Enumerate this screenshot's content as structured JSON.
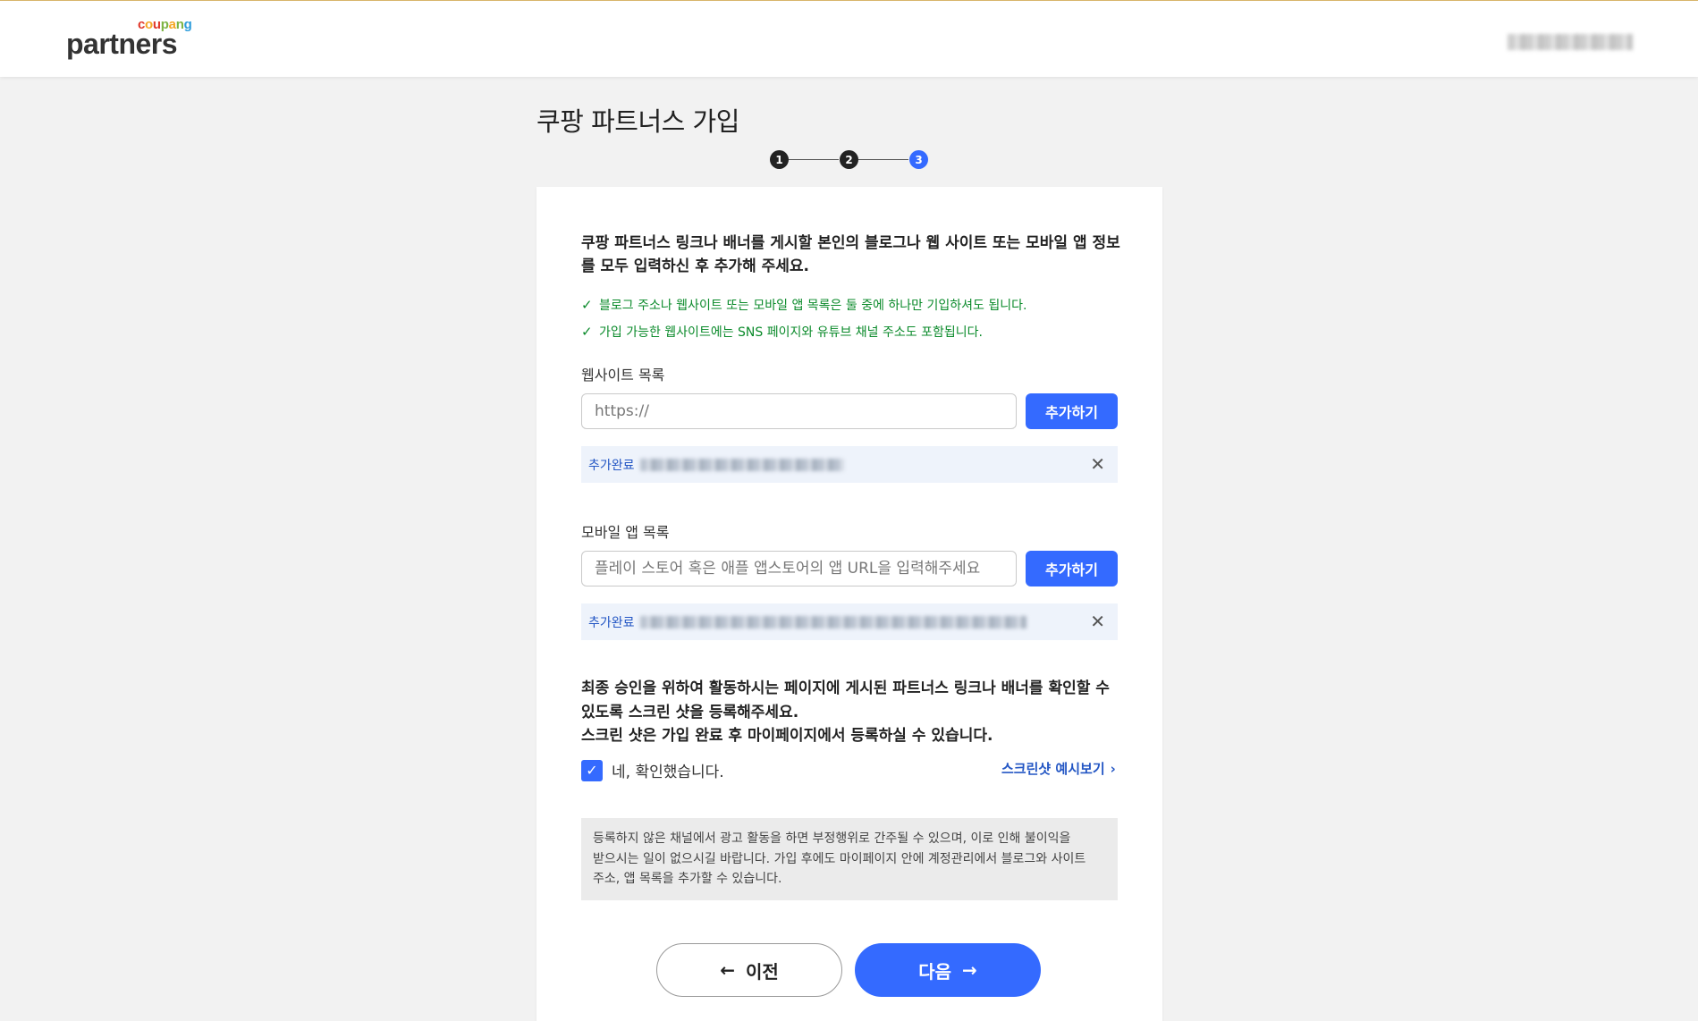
{
  "header": {
    "logo_sub": "coupang",
    "logo_main": "partners",
    "logo_colors": [
      "#e0382a",
      "#f5a623",
      "#7cb342",
      "#2d9cdb"
    ]
  },
  "page": {
    "title": "쿠팡 파트너스 가입",
    "steps": [
      "1",
      "2",
      "3"
    ],
    "active_step": 3
  },
  "intro_text": "쿠팡 파트너스 링크나 배너를 게시할 본인의 블로그나 웹 사이트 또는 모바일 앱 정보를 모두 입력하신 후 추가해 주세요.",
  "checks": [
    "블로그 주소나 웹사이트 또는 모바일 앱 목록은 둘 중에 하나만 기입하셔도 됩니다.",
    "가입 가능한 웹사이트에는 SNS 페이지와 유튜브 채널 주소도 포함됩니다."
  ],
  "website": {
    "label": "웹사이트 목록",
    "placeholder": "https://",
    "add_label": "추가하기",
    "added_tag": "추가완료"
  },
  "app": {
    "label": "모바일 앱 목록",
    "placeholder": "플레이 스토어 혹은 애플 앱스토어의 앱 URL을 입력해주세요",
    "add_label": "추가하기",
    "added_tag": "추가완료"
  },
  "notice_lines": [
    "최종 승인을 위하여 활동하시는 페이지에 게시된 파트너스 링크나 배너를 확인할 수",
    "있도록 스크린 샷을 등록해주세요.",
    "스크린 샷은 가입 완료 후 마이페이지에서 등록하실 수 있습니다."
  ],
  "confirm": {
    "label": "네, 확인했습니다.",
    "checked": true,
    "preview_link": "스크린샷 예시보기"
  },
  "info_lines": [
    "등록하지 않은 채널에서 광고 활동을 하면 부정행위로 간주될 수 있으며, 이로 인해 불이익을",
    "받으시는 일이 없으시길 바랍니다. 가입 후에도 마이페이지 안에 계정관리에서 블로그와 사이트",
    "주소, 앱 목록을 추가할 수 있습니다."
  ],
  "buttons": {
    "prev": "이전",
    "next": "다음"
  },
  "colors": {
    "accent": "#346aff",
    "success": "#0a8a2a",
    "link": "#2356c4"
  }
}
